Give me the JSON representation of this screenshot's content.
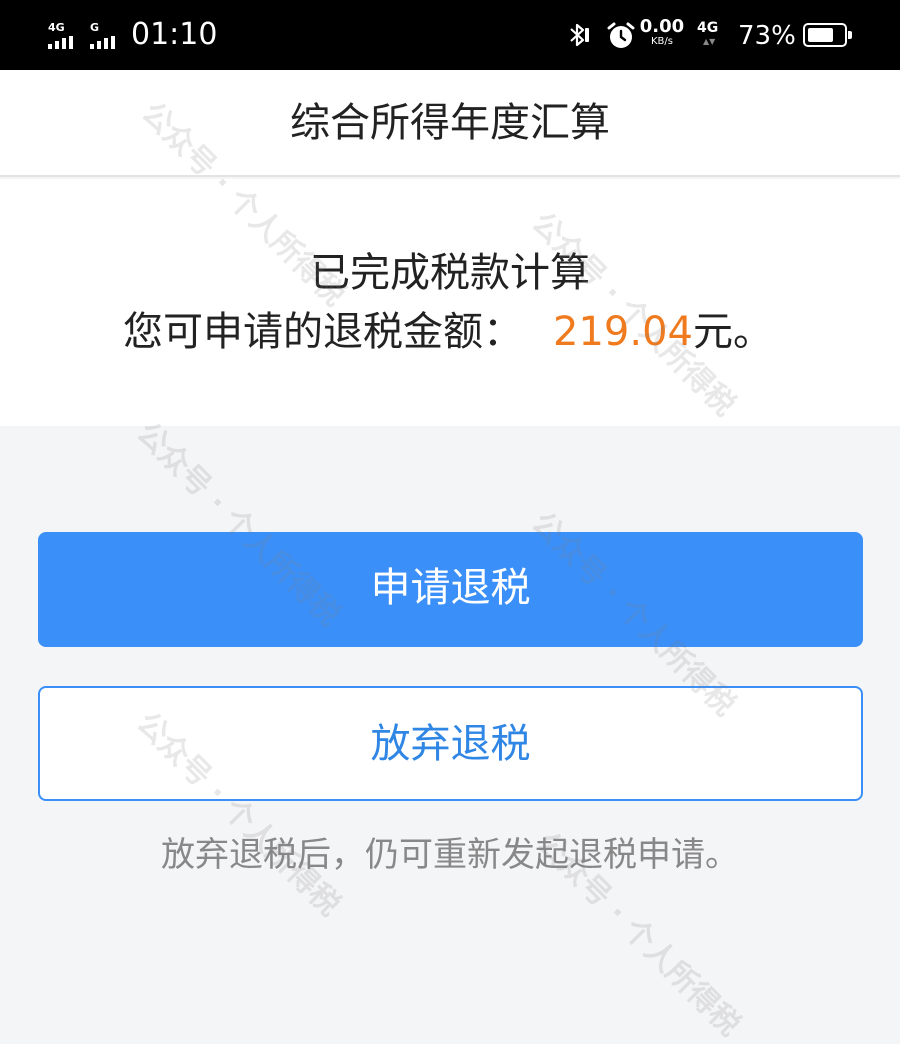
{
  "status_bar": {
    "sim1_tag": "4G",
    "sim2_tag": "G",
    "time": "01:10",
    "net_speed_value": "0.00",
    "net_speed_unit": "KB/s",
    "network_type": "4G",
    "battery_percent": "73%",
    "battery_level": 0.73,
    "icons": [
      "signal-icon",
      "bluetooth-icon",
      "alarm-icon",
      "battery-icon"
    ]
  },
  "header": {
    "title": "综合所得年度汇算"
  },
  "result": {
    "line1": "已完成税款计算",
    "refund_label": "您可申请的退税金额：",
    "refund_amount": "219.04",
    "refund_suffix": "元。"
  },
  "actions": {
    "apply_label": "申请退税",
    "abandon_label": "放弃退税"
  },
  "note": "放弃退税后，仍可重新发起退税申请。",
  "watermark": "公众号 · 个人所得税",
  "colors": {
    "primary": "#3a8ff8",
    "amount": "#f07a1e",
    "status_bar_bg": "#000000",
    "page_bg": "#f4f5f7"
  }
}
